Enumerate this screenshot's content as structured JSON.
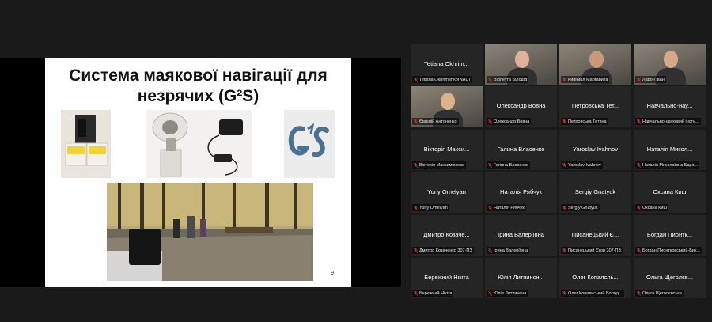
{
  "slide": {
    "title": "Система маякової навігації для незрячих (G²S)",
    "page_number": "9"
  },
  "colors": {
    "active_speaker": "#9acd32",
    "mic_muted": "#e02828",
    "tile_bg": "#252525"
  },
  "participants": [
    {
      "display": "Tetiana Okhrim...",
      "label": "Tetiana Okhrimenko(NAU)",
      "video": false
    },
    {
      "display": "",
      "label": "Віолетта Білодід",
      "video": true
    },
    {
      "display": "",
      "label": "Кипниця Маргарита",
      "video": true
    },
    {
      "display": "",
      "label": "Ларон Іван",
      "video": true
    },
    {
      "display": "",
      "label": "Євгеній Антоненко",
      "video": true,
      "active": true
    },
    {
      "display": "Олександр Вовна",
      "label": "Олександр Вовна",
      "video": false
    },
    {
      "display": "Петровська Тет...",
      "label": "Петровська Тетяна",
      "video": false
    },
    {
      "display": "Навчально-нау...",
      "label": "Навчально-науковий інсти...",
      "video": false
    },
    {
      "display": "Вікторія Макси...",
      "label": "Вікторія Максимюкова",
      "video": false
    },
    {
      "display": "Галина Власенко",
      "label": "Галина Власенко",
      "video": false
    },
    {
      "display": "Yaroslav Ivahnov",
      "label": "Yaroslav Ivahnov",
      "video": false
    },
    {
      "display": "Наталія Микол...",
      "label": "Наталія Миколаївна Бара...",
      "video": false
    },
    {
      "display": "Yuriy Omelyan",
      "label": "Yuriy Omelyan",
      "video": false
    },
    {
      "display": "Наталія Рябчук",
      "label": "Наталія Рябчук",
      "video": false
    },
    {
      "display": "Sergiy Gnatyuk",
      "label": "Sergiy Gnatyuk",
      "video": false
    },
    {
      "display": "Оксана Киш",
      "label": "Оксана Киш",
      "video": false
    },
    {
      "display": "Дмитро Козаче...",
      "label": "Дмитро Козаченко 307-ПЗ",
      "video": false
    },
    {
      "display": "Ірина Валеріївна",
      "label": "Ірина Валеріївна",
      "video": false
    },
    {
      "display": "Писанецький Є...",
      "label": "Писанецький Єгор 307-ПЗ",
      "video": false
    },
    {
      "display": "Богдан Пионтк...",
      "label": "Богдан Пионтковський-Бик...",
      "video": false
    },
    {
      "display": "Бережний Нікіта",
      "label": "Бережний Нікіта",
      "video": false
    },
    {
      "display": "Юлія Литпинсн...",
      "label": "Юлія Литпинсна",
      "video": false
    },
    {
      "display": "Олег Копалсль...",
      "label": "Олег Ковальський Волод...",
      "video": false
    },
    {
      "display": "Ольга Щеголєв...",
      "label": "Ольга Щеголєвська",
      "video": false
    }
  ]
}
